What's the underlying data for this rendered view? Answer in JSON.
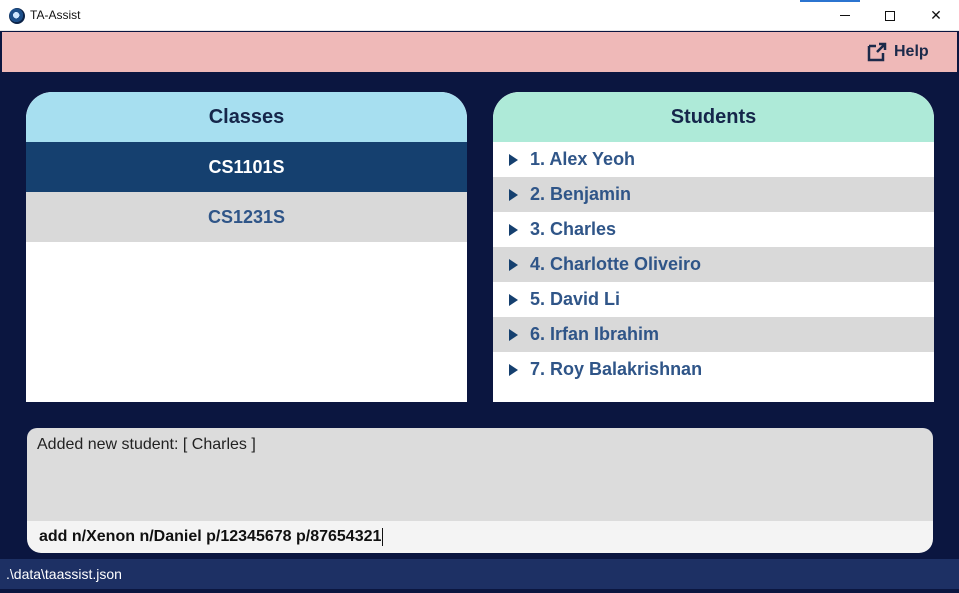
{
  "window": {
    "title": "TA-Assist",
    "controls": {
      "minimize": "minimize",
      "maximize": "maximize",
      "close": "✕"
    }
  },
  "toolbar": {
    "help_label": "Help"
  },
  "classes": {
    "title": "Classes",
    "items": [
      {
        "label": "CS1101S",
        "selected": true
      },
      {
        "label": "CS1231S",
        "selected": false
      }
    ]
  },
  "students": {
    "title": "Students",
    "items": [
      {
        "label": "1. Alex Yeoh"
      },
      {
        "label": "2. Benjamin"
      },
      {
        "label": "3. Charles"
      },
      {
        "label": "4. Charlotte Oliveiro"
      },
      {
        "label": "5. David Li"
      },
      {
        "label": "6. Irfan Ibrahim"
      },
      {
        "label": "7. Roy Balakrishnan"
      }
    ]
  },
  "result": {
    "text": "Added new student: [ Charles ]"
  },
  "command": {
    "value": "add n/Xenon n/Daniel p/12345678 p/87654321"
  },
  "status": {
    "path": ".\\data\\taassist.json"
  },
  "colors": {
    "background": "#0b1640",
    "toolbar": "#efb9b8",
    "classes_header": "#a7dff0",
    "students_header": "#aeead8",
    "selected_item": "#15406f",
    "list_text": "#2f5588",
    "status_bar": "#1d3064"
  }
}
